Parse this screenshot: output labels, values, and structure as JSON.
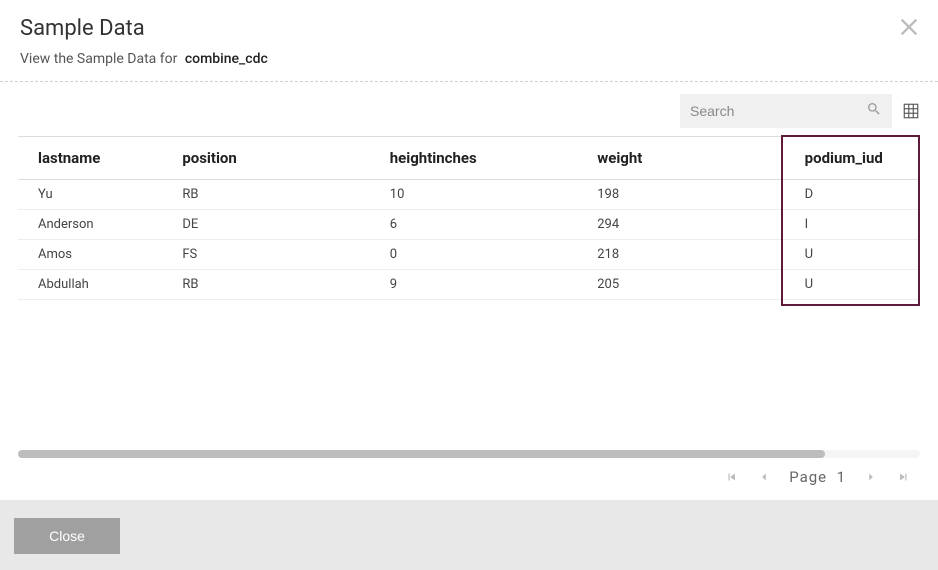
{
  "header": {
    "title": "Sample Data",
    "subtitle_prefix": "View the Sample Data for",
    "dataset_name": "combine_cdc"
  },
  "search": {
    "placeholder": "Search",
    "value": ""
  },
  "table": {
    "columns": [
      "lastname",
      "position",
      "heightinches",
      "weight",
      "podium_iud"
    ],
    "rows": [
      {
        "lastname": "Yu",
        "position": "RB",
        "heightinches": "10",
        "weight": "198",
        "podium_iud": "D"
      },
      {
        "lastname": "Anderson",
        "position": "DE",
        "heightinches": "6",
        "weight": "294",
        "podium_iud": "I"
      },
      {
        "lastname": "Amos",
        "position": "FS",
        "heightinches": "0",
        "weight": "218",
        "podium_iud": "U"
      },
      {
        "lastname": "Abdullah",
        "position": "RB",
        "heightinches": "9",
        "weight": "205",
        "podium_iud": "U"
      }
    ],
    "highlighted_column": 4
  },
  "pagination": {
    "page_label": "Page",
    "current_page": "1"
  },
  "footer": {
    "close_label": "Close"
  }
}
